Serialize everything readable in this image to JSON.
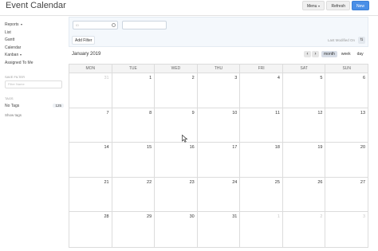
{
  "header": {
    "title": "Event Calendar",
    "menu_label": "Menu",
    "refresh_label": "Refresh",
    "new_label": "New"
  },
  "sidebar": {
    "items": [
      {
        "label": "Reports",
        "dropdown": true
      },
      {
        "label": "List",
        "dropdown": false
      },
      {
        "label": "Gantt",
        "dropdown": false
      },
      {
        "label": "Calendar",
        "dropdown": false
      },
      {
        "label": "Kanban",
        "dropdown": true
      },
      {
        "label": "Assigned To Me",
        "dropdown": false
      }
    ],
    "save_filter_label": "SAVE FILTER",
    "filter_name_placeholder": "Filter Name",
    "tags_label": "TAGS",
    "no_tags_label": "No Tags",
    "no_tags_count": "125",
    "show_tags_label": "Show tags"
  },
  "filters": {
    "id_placeholder": "ID",
    "add_filter_label": "Add Filter",
    "last_modified_label": "Last Modified On",
    "sort_icon": "sort-icon"
  },
  "calendar": {
    "month_title": "January 2019",
    "prev_icon": "chevron-left-icon",
    "next_icon": "chevron-right-icon",
    "views": [
      "month",
      "week",
      "day"
    ],
    "active_view": "month",
    "weekdays": [
      "MON",
      "TUE",
      "WED",
      "THU",
      "FRI",
      "SAT",
      "SUN"
    ],
    "weeks": [
      [
        {
          "d": "31",
          "o": true
        },
        {
          "d": "1"
        },
        {
          "d": "2"
        },
        {
          "d": "3"
        },
        {
          "d": "4"
        },
        {
          "d": "5"
        },
        {
          "d": "6"
        }
      ],
      [
        {
          "d": "7"
        },
        {
          "d": "8"
        },
        {
          "d": "9"
        },
        {
          "d": "10"
        },
        {
          "d": "11"
        },
        {
          "d": "12"
        },
        {
          "d": "13"
        }
      ],
      [
        {
          "d": "14"
        },
        {
          "d": "15"
        },
        {
          "d": "16"
        },
        {
          "d": "17"
        },
        {
          "d": "18"
        },
        {
          "d": "19"
        },
        {
          "d": "20"
        }
      ],
      [
        {
          "d": "21"
        },
        {
          "d": "22"
        },
        {
          "d": "23"
        },
        {
          "d": "24"
        },
        {
          "d": "25"
        },
        {
          "d": "26"
        },
        {
          "d": "27"
        }
      ],
      [
        {
          "d": "28"
        },
        {
          "d": "29"
        },
        {
          "d": "30"
        },
        {
          "d": "31"
        },
        {
          "d": "1",
          "o": true
        },
        {
          "d": "2",
          "o": true
        },
        {
          "d": "3",
          "o": true
        }
      ]
    ]
  },
  "colors": {
    "primary": "#4a8fe7",
    "filter_bar_bg": "#f4f8fc"
  }
}
